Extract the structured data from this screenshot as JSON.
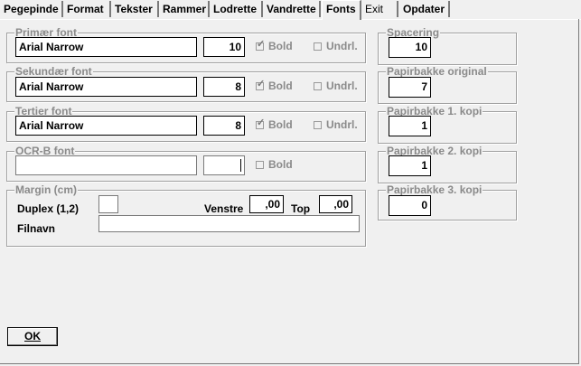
{
  "tabs": [
    "Pegepinde",
    "Format",
    "Tekster",
    "Rammer",
    "Lodrette",
    "Vandrette",
    "Fonts",
    "Exit",
    "Opdater"
  ],
  "active_tab": "Fonts",
  "fonts": {
    "primary": {
      "label": "Primær font",
      "font": "Arial Narrow",
      "size": "10",
      "bold_label": "Bold",
      "underline_label": "Undrl.",
      "bold_mark": "✓"
    },
    "secondary": {
      "label": "Sekundær font",
      "font": "Arial Narrow",
      "size": "8",
      "bold_label": "Bold",
      "underline_label": "Undrl.",
      "bold_mark": "✓"
    },
    "tertiary": {
      "label": "Tertier font",
      "font": "Arial Narrow",
      "size": "8",
      "bold_label": "Bold",
      "underline_label": "Undrl.",
      "bold_mark": "✓"
    },
    "ocrb": {
      "label": "OCR-B font",
      "font": "",
      "size": "",
      "bold_label": "Bold"
    }
  },
  "margin": {
    "label": "Margin (cm)",
    "duplex_label": "Duplex (1,2)",
    "duplex_value": "",
    "left_label": "Venstre",
    "left_value": ",00",
    "top_label": "Top",
    "top_value": ",00",
    "filename_label": "Filnavn",
    "filename_value": ""
  },
  "right": {
    "spacing": {
      "label": "Spacering",
      "value": "10"
    },
    "tray_original": {
      "label": "Papirbakke original",
      "value": "7"
    },
    "tray_copy1": {
      "label": "Papirbakke 1. kopi",
      "value": "1"
    },
    "tray_copy2": {
      "label": "Papirbakke 2. kopi",
      "value": "1"
    },
    "tray_copy3": {
      "label": "Papirbakke 3. kopi",
      "value": "0"
    }
  },
  "ok_label": "OK"
}
